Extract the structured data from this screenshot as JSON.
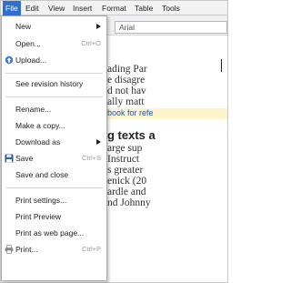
{
  "menubar": {
    "items": [
      "File",
      "Edit",
      "View",
      "Insert",
      "Format",
      "Table",
      "Tools"
    ]
  },
  "file_menu": {
    "items": [
      {
        "label": "New",
        "submenu": true
      },
      {
        "label": "Open...",
        "shortcut": "Ctrl+O"
      },
      {
        "label": "Upload...",
        "icon": "upload-icon"
      },
      {
        "label": "See revision history"
      },
      {
        "label": "Rename..."
      },
      {
        "label": "Make a copy..."
      },
      {
        "label": "Download as",
        "submenu": true
      },
      {
        "label": "Save",
        "shortcut": "Ctrl+S",
        "icon": "save-disk-icon"
      },
      {
        "label": "Save and close"
      },
      {
        "label": "Print settings..."
      },
      {
        "label": "Print Preview"
      },
      {
        "label": "Print as web page..."
      },
      {
        "label": "Print...",
        "shortcut": "Ctrl+P",
        "icon": "printer-icon"
      }
    ]
  },
  "document": {
    "font_name": "Arial",
    "lines": [
      "ading Par",
      "e disagre",
      "d not hav",
      "ally matt"
    ],
    "link_text": "book for refe",
    "heading": "g texts a",
    "lines2": [
      "arge sup",
      "Instruct",
      "s greater",
      "enick (20",
      "ardle and",
      "nd Johnny"
    ]
  },
  "colors": {
    "menu_active_bg": "#2f6fce",
    "link_color": "#2a55b9",
    "link_highlight": "#fbf5c9"
  }
}
